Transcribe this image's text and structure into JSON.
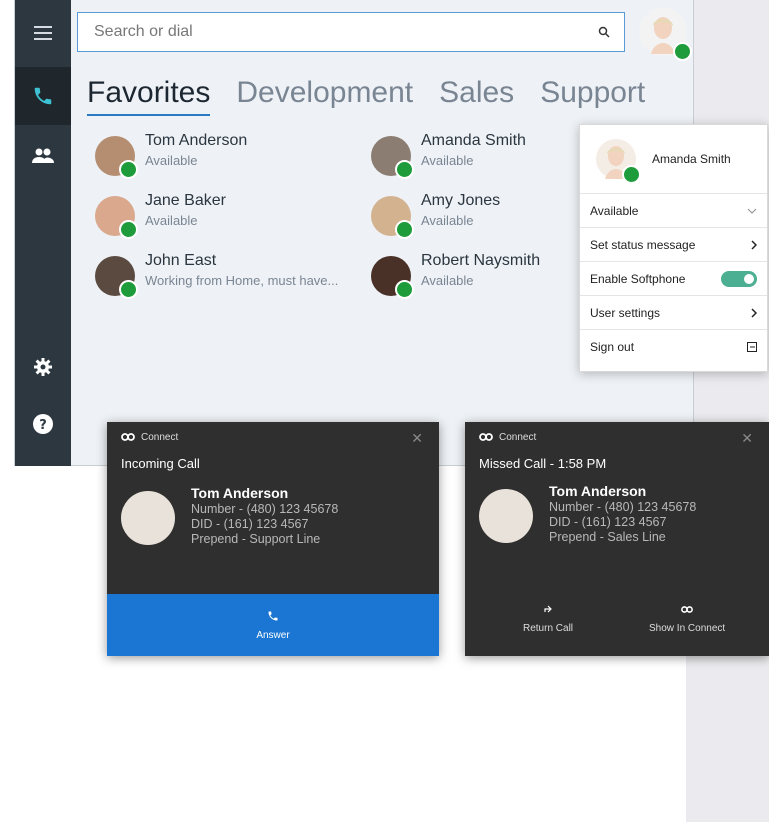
{
  "search": {
    "placeholder": "Search or dial"
  },
  "tabs": [
    {
      "label": "Favorites"
    },
    {
      "label": "Development"
    },
    {
      "label": "Sales"
    },
    {
      "label": "Support"
    }
  ],
  "favorites": [
    {
      "name": "Tom Anderson",
      "status": "Available"
    },
    {
      "name": "Amanda Smith",
      "status": "Available"
    },
    {
      "name": "Jane Baker",
      "status": "Available"
    },
    {
      "name": "Amy Jones",
      "status": "Available"
    },
    {
      "name": "John East",
      "status": "Working from Home, must have..."
    },
    {
      "name": "Robert Naysmith",
      "status": "Available"
    }
  ],
  "user_menu": {
    "name": "Amanda Smith",
    "status": "Available",
    "set_status": "Set status message",
    "softphone": "Enable Softphone",
    "softphone_enabled": true,
    "settings": "User settings",
    "sign_out": "Sign out"
  },
  "incoming": {
    "app": "Connect",
    "title": "Incoming Call",
    "caller": "Tom Anderson",
    "number": "Number - (480) 123 45678",
    "did": "DID - (161) 123 4567",
    "prepend": "Prepend - Support Line",
    "answer": "Answer"
  },
  "missed": {
    "app": "Connect",
    "title": "Missed Call - 1:58 PM",
    "caller": "Tom Anderson",
    "number": "Number - (480) 123 45678",
    "did": "DID - (161) 123 4567",
    "prepend": "Prepend - Sales Line",
    "return_call": "Return Call",
    "show_connect": "Show In Connect"
  },
  "colors": {
    "accent": "#1a76d2",
    "online": "#1e9b3a",
    "sidebar": "#2d3740",
    "toggle": "#4caf92"
  }
}
